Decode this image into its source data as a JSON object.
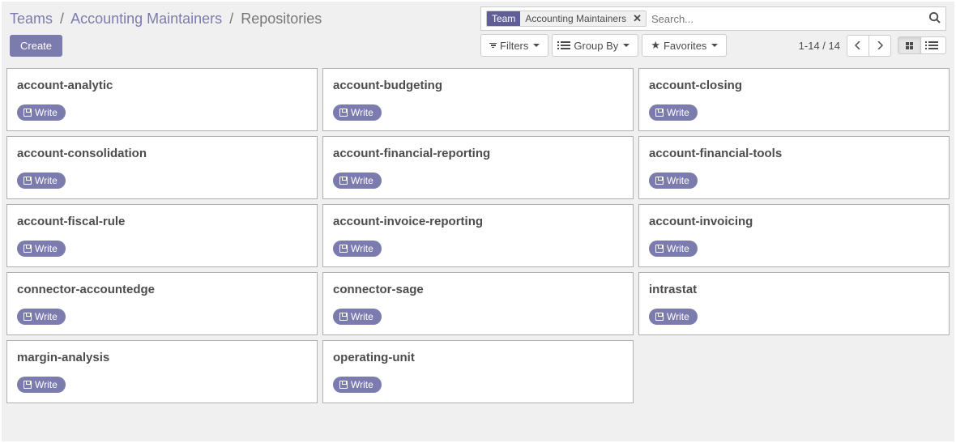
{
  "breadcrumb": {
    "root": "Teams",
    "parent": "Accounting Maintainers",
    "current": "Repositories"
  },
  "search": {
    "facet_label": "Team",
    "facet_value": "Accounting Maintainers",
    "placeholder": "Search..."
  },
  "buttons": {
    "create": "Create",
    "filters": "Filters",
    "group_by": "Group By",
    "favorites": "Favorites"
  },
  "pager": {
    "range_text": "1-14 / 14"
  },
  "card_action": "Write",
  "cards": [
    {
      "name": "account-analytic"
    },
    {
      "name": "account-budgeting"
    },
    {
      "name": "account-closing"
    },
    {
      "name": "account-consolidation"
    },
    {
      "name": "account-financial-reporting"
    },
    {
      "name": "account-financial-tools"
    },
    {
      "name": "account-fiscal-rule"
    },
    {
      "name": "account-invoice-reporting"
    },
    {
      "name": "account-invoicing"
    },
    {
      "name": "connector-accountedge"
    },
    {
      "name": "connector-sage"
    },
    {
      "name": "intrastat"
    },
    {
      "name": "margin-analysis"
    },
    {
      "name": "operating-unit"
    }
  ]
}
